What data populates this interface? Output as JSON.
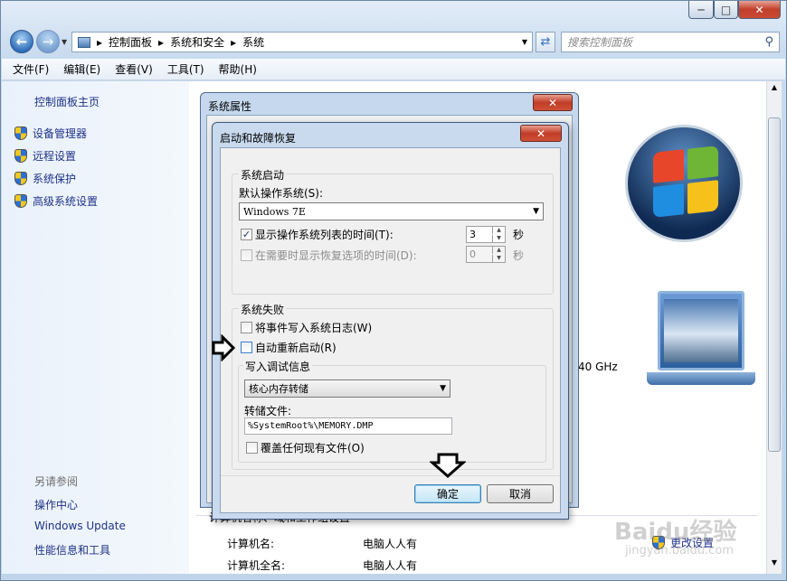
{
  "window": {
    "caption_buttons": [
      "─",
      "□",
      "✕"
    ]
  },
  "address": {
    "crumbs": [
      "控制面板",
      "系统和安全",
      "系统"
    ],
    "separator": "▸"
  },
  "search": {
    "placeholder": "搜索控制面板"
  },
  "menu": [
    "文件(F)",
    "编辑(E)",
    "查看(V)",
    "工具(T)",
    "帮助(H)"
  ],
  "sidebar": {
    "home": "控制面板主页",
    "items": [
      "设备管理器",
      "远程设置",
      "系统保护",
      "高级系统设置"
    ],
    "see_also_title": "另请参阅",
    "see_also": [
      "操作中心",
      "Windows Update",
      "性能信息和工具"
    ]
  },
  "content": {
    "ghz_text": "40 GHz",
    "section_heading": "计算机名称、域和工作组设置",
    "rows": [
      {
        "label": "计算机名:",
        "value": "电脑人人有"
      },
      {
        "label": "计算机全名:",
        "value": "电脑人人有"
      }
    ],
    "change_settings": "更改设置"
  },
  "sysprop_dialog": {
    "title": "系统属性",
    "close": "✕"
  },
  "dialog": {
    "title": "启动和故障恢复",
    "close": "✕",
    "startup": {
      "group_title": "系统启动",
      "default_os_label": "默认操作系统(S):",
      "default_os_value": "Windows 7E",
      "show_list_label": "显示操作系统列表的时间(T):",
      "show_list_checked": "✓",
      "show_list_value": "3",
      "show_recovery_label": "在需要时显示恢复选项的时间(D):",
      "show_recovery_value": "0",
      "seconds": "秒"
    },
    "failure": {
      "group_title": "系统失败",
      "write_event_label": "将事件写入系统日志(W)",
      "auto_restart_label": "自动重新启动(R)",
      "debug_group_title": "写入调试信息",
      "debug_type": "核心内存转储",
      "dump_file_label": "转储文件:",
      "dump_file_value": "%SystemRoot%\\MEMORY.DMP",
      "overwrite_label": "覆盖任何现有文件(O)"
    },
    "ok": "确定",
    "cancel": "取消"
  },
  "watermark": {
    "brand": "Baidu经验",
    "url": "jingyan.baidu.com"
  },
  "colors": {
    "link": "#1e3287",
    "title_bar": "#c9daee",
    "close_red": "#c13c27",
    "accent_blue": "#3f7fd1"
  }
}
